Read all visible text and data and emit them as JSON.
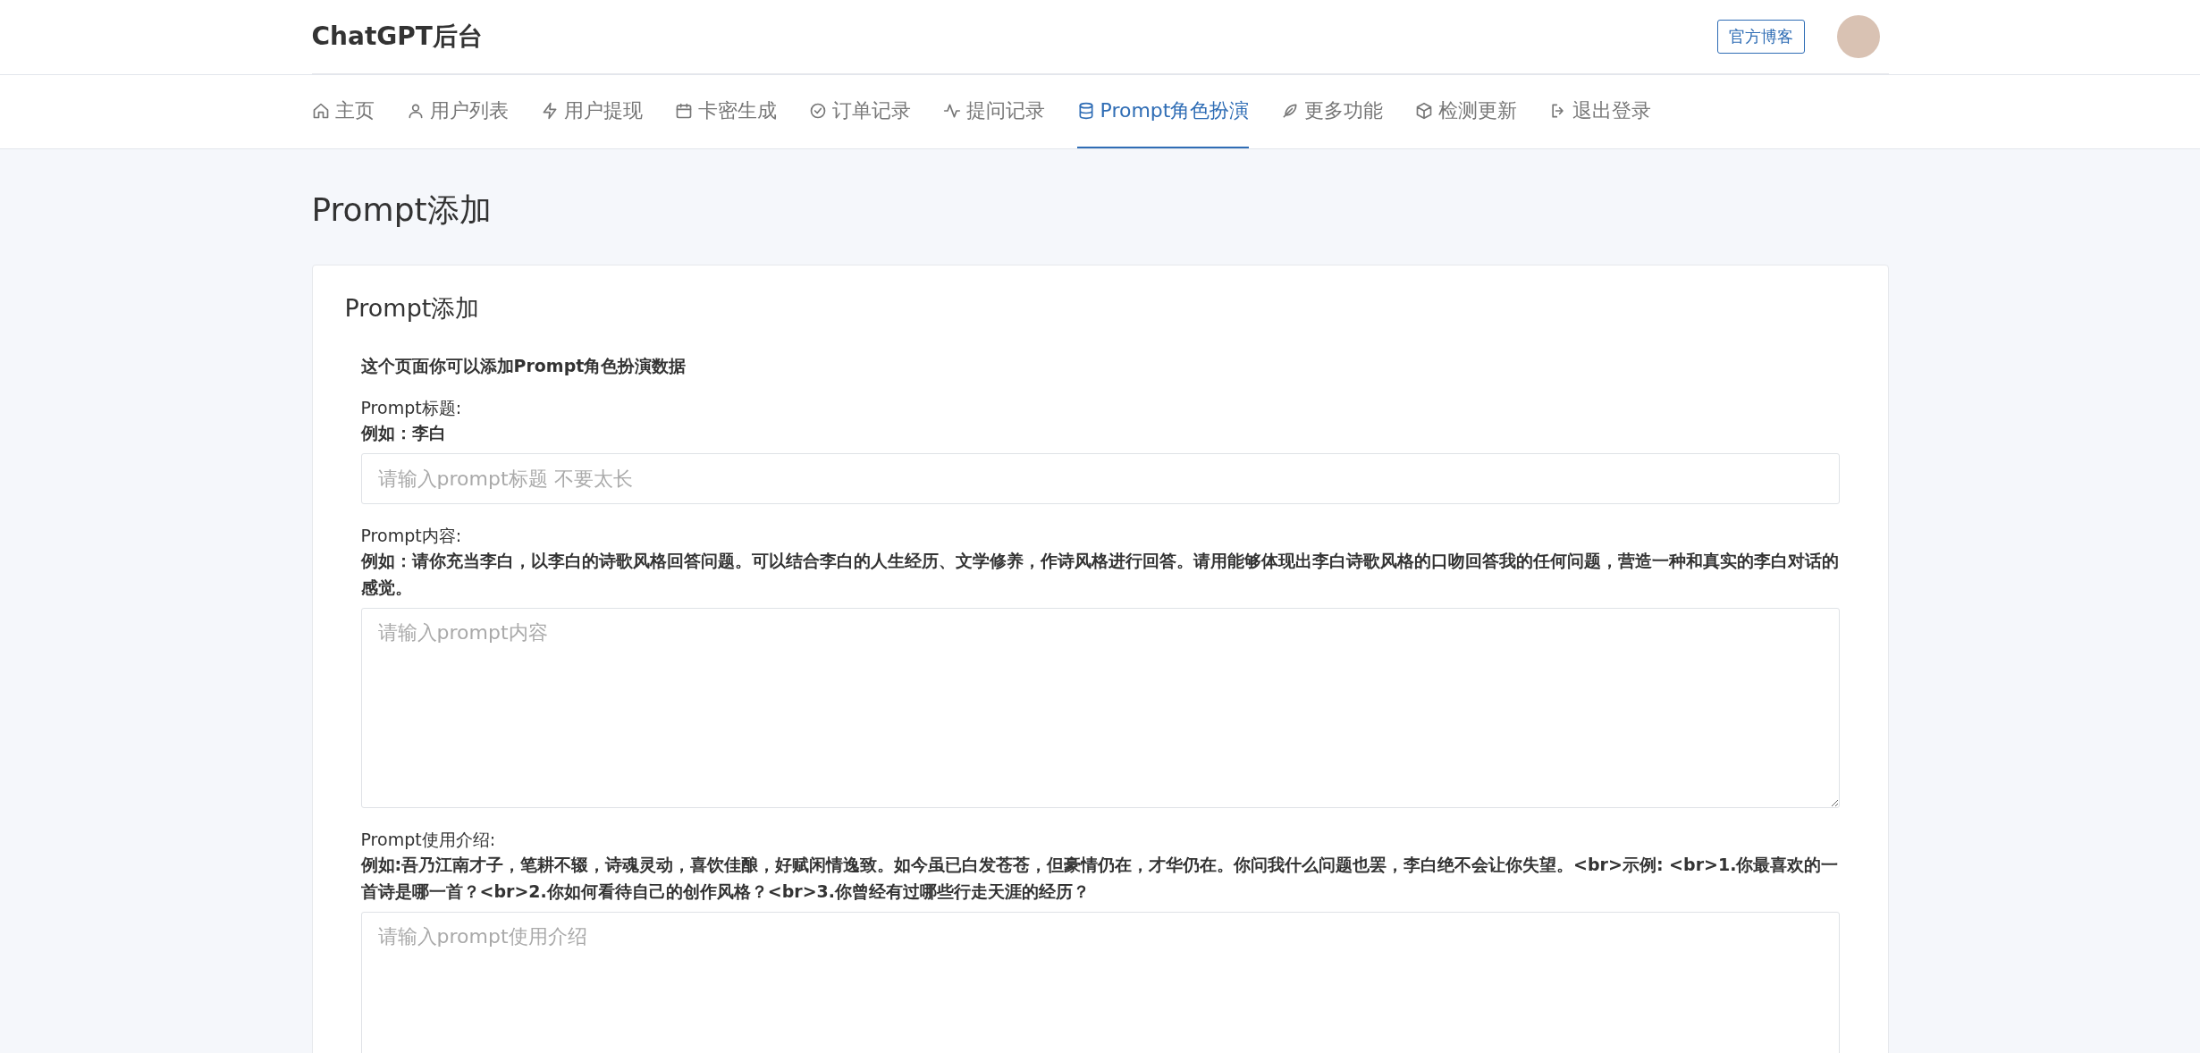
{
  "header": {
    "brand": "ChatGPT后台",
    "blog_button": "官方博客"
  },
  "nav": [
    {
      "label": "主页",
      "selected": false
    },
    {
      "label": "用户列表",
      "selected": false
    },
    {
      "label": "用户提现",
      "selected": false
    },
    {
      "label": "卡密生成",
      "selected": false
    },
    {
      "label": "订单记录",
      "selected": false
    },
    {
      "label": "提问记录",
      "selected": false
    },
    {
      "label": "Prompt角色扮演",
      "selected": true
    },
    {
      "label": "更多功能",
      "selected": false
    },
    {
      "label": "检测更新",
      "selected": false
    },
    {
      "label": "退出登录",
      "selected": false
    }
  ],
  "page_title": "Prompt添加",
  "card": {
    "title": "Prompt添加",
    "intro": "这个页面你可以添加Prompt角色扮演数据",
    "fields": [
      {
        "kind": "input",
        "label": "Prompt标题:",
        "example": "例如：李白",
        "placeholder": "请输入prompt标题 不要太长"
      },
      {
        "kind": "textarea",
        "label": "Prompt内容:",
        "example": "例如：请你充当李白，以李白的诗歌风格回答问题。可以结合李白的人生经历、文学修养，作诗风格进行回答。请用能够体现出李白诗歌风格的口吻回答我的任何问题，营造一种和真实的李白对话的感觉。",
        "placeholder": "请输入prompt内容"
      },
      {
        "kind": "textarea",
        "label": "Prompt使用介绍:",
        "example": "例如:吾乃江南才子，笔耕不辍，诗魂灵动，喜饮佳酿，好赋闲情逸致。如今虽已白发苍苍，但豪情仍在，才华仍在。你问我什么问题也罢，李白绝不会让你失望。<br>示例: <br>1.你最喜欢的一首诗是哪一首？<br>2.你如何看待自己的创作风格？<br>3.你曾经有过哪些行走天涯的经历？",
        "placeholder": "请输入prompt使用介绍"
      }
    ]
  }
}
